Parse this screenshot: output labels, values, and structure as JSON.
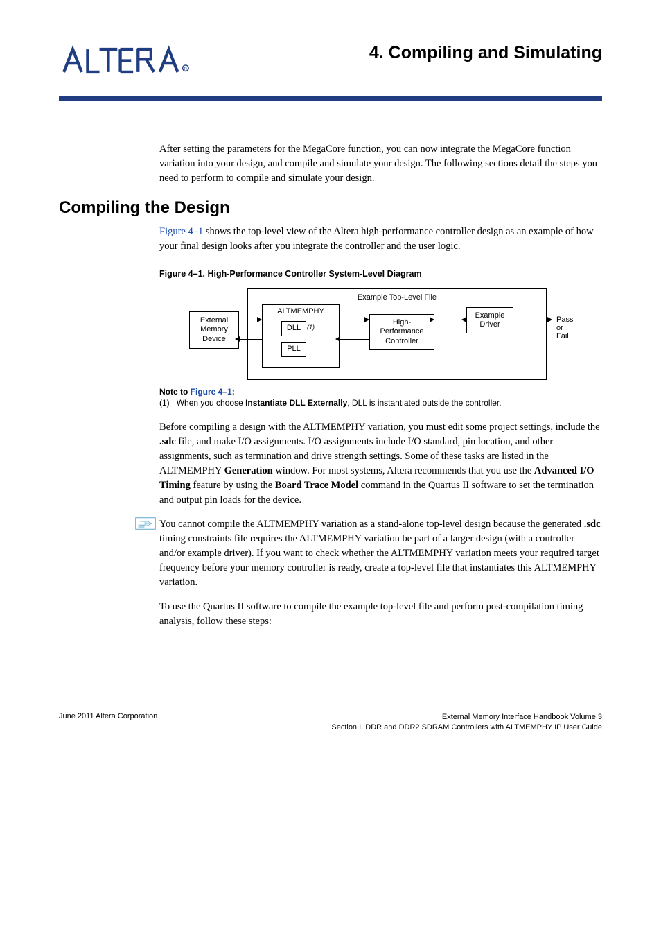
{
  "chapter": {
    "number_title": "4.  Compiling and Simulating"
  },
  "intro_para": "After setting the parameters for the MegaCore function, you can now integrate the MegaCore function variation into your design, and compile and simulate your design. The following sections detail the steps you need to perform to compile and simulate your design.",
  "section1": {
    "heading": "Compiling the Design",
    "para_lead_link": "Figure 4–1",
    "para_lead_rest": " shows the top-level view of the Altera high-performance controller design as an example of how your final design looks after you integrate the controller and the user logic."
  },
  "figure": {
    "caption": "Figure 4–1.  High-Performance Controller System-Level Diagram",
    "top_label": "Example Top-Level File",
    "ext_mem": "External\nMemory\nDevice",
    "altm": "ALTMEMPHY",
    "dll": "DLL",
    "pll": "PLL",
    "dll_note": "(1)",
    "hpc": "High-\nPerformance\nController",
    "driver": "Example\nDriver",
    "pass_fail": "Pass or Fail"
  },
  "figure_note": {
    "head_prefix": "Note to ",
    "head_link": "Figure 4–1",
    "head_suffix": ":",
    "line_num": "(1)",
    "line_text_a": "When you choose ",
    "line_bold": "Instantiate DLL Externally",
    "line_text_b": ", DLL is instantiated outside the controller."
  },
  "body2_a": "Before compiling a design with the ALTMEMPHY variation, you must edit some project settings, include the ",
  "body2_b": ".sdc",
  "body2_c": " file, and make I/O assignments. I/O assignments include I/O standard, pin location, and other assignments, such as termination and drive strength settings. Some of these tasks are listed in the ALTMEMPHY ",
  "body2_d": "Generation",
  "body2_e": " window. For most systems, Altera recommends that you use the ",
  "body2_f": "Advanced I/O Timing",
  "body2_g": " feature by using the ",
  "body2_h": "Board Trace Model",
  "body2_i": " command in the Quartus II software to set the termination and output pin loads for the device.",
  "note_para_a": "You cannot compile the ALTMEMPHY variation as a stand-alone top-level design because the generated ",
  "note_para_b": ".sdc",
  "note_para_c": " timing constraints file requires the ALTMEMPHY variation be part of a larger design (with a controller and/or example driver). If you want to check whether the ALTMEMPHY variation meets your required target frequency before your memory controller is ready, create a top-level file that instantiates this ALTMEMPHY variation.",
  "body3": "To use the Quartus II software to compile the example top-level file and perform post-compilation timing analysis, follow these steps:",
  "footer": {
    "left": "June 2011   Altera Corporation",
    "right1": "External Memory Interface Handbook Volume 3",
    "right2": "Section I. DDR and DDR2 SDRAM Controllers with ALTMEMPHY IP User Guide"
  }
}
